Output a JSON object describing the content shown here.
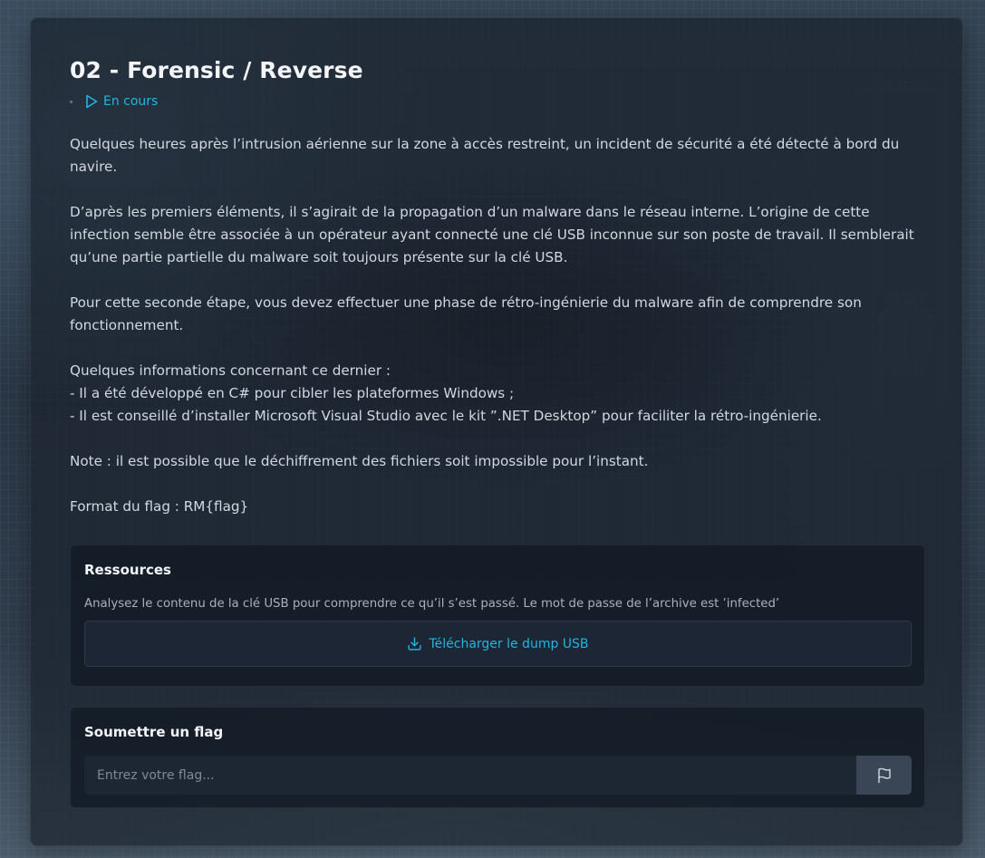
{
  "challenge": {
    "title": "02 - Forensic / Reverse",
    "status": "En cours",
    "status_icon": "play-icon",
    "accent_color": "#22b5e0",
    "description": {
      "p1": "Quelques heures après l’intrusion aérienne sur la zone à accès restreint, un incident de sécurité a été détecté à bord du navire.",
      "p2": "D’après les premiers éléments, il s’agirait de la propagation d’un malware dans le réseau interne. L’origine de cette infection semble être associée à un opérateur ayant connecté une clé USB inconnue sur son poste de travail. Il semblerait qu’une partie partielle du malware soit toujours présente sur la clé USB.",
      "p3": "Pour cette seconde étape, vous devez effectuer une phase de rétro-ingénierie du malware afin de comprendre son fonctionnement.",
      "p4_line1": "Quelques informations concernant ce dernier :",
      "p4_line2": "- Il a été développé en C# pour cibler les plateformes Windows ;",
      "p4_line3": "- Il est conseillé d’installer Microsoft Visual Studio avec le kit ”.NET Desktop” pour faciliter la rétro-ingénierie.",
      "p5": "Note : il est possible que le déchiffrement des fichiers soit impossible pour l’instant.",
      "p6": "Format du flag : RM{flag}"
    }
  },
  "resources": {
    "heading": "Ressources",
    "text": "Analysez le contenu de la clé USB pour comprendre ce qu’il s’est passé. Le mot de passe de l’archive est ’infected’",
    "download_label": "Télécharger le dump USB",
    "download_icon": "download-icon"
  },
  "flag": {
    "heading": "Soumettre un flag",
    "placeholder": "Entrez votre flag...",
    "value": "",
    "submit_icon": "flag-icon"
  }
}
